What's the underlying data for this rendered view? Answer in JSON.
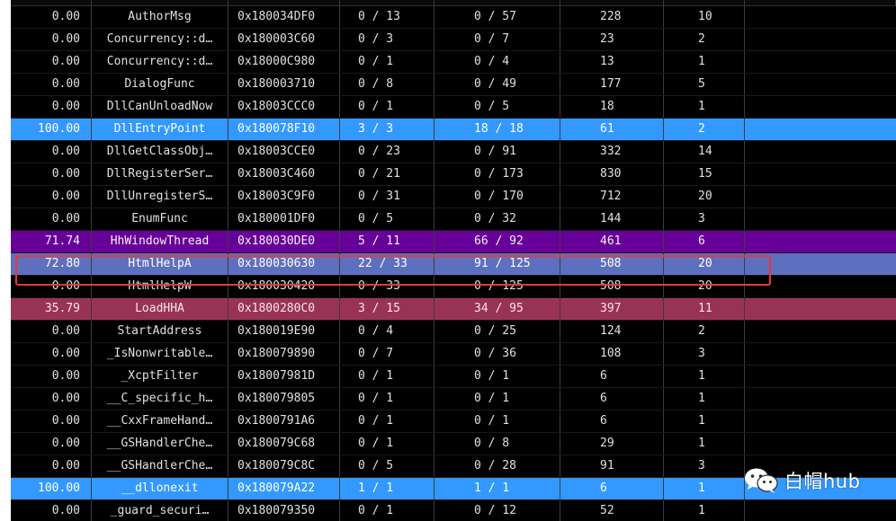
{
  "colors": {
    "background": "#000000",
    "text": "#e0e0e0",
    "selected_blue": "#3399ff",
    "purple": "#660099",
    "slate": "#5f6fbf",
    "rose": "#993355",
    "annotation_box": "#e53a3a"
  },
  "watermark": {
    "icon": "wechat-icon",
    "text": "白帽hub"
  },
  "rows": [
    {
      "cov": "0.00",
      "name": "AuthorMsg",
      "addr": "0x180034DF0",
      "blocks": "0 / 13",
      "instr": "0 / 57",
      "size": "228",
      "cc": "10",
      "style": ""
    },
    {
      "cov": "0.00",
      "name": "Concurrency::d…",
      "addr": "0x180003C60",
      "blocks": "0 / 3",
      "instr": "0 / 7",
      "size": "23",
      "cc": "2",
      "style": ""
    },
    {
      "cov": "0.00",
      "name": "Concurrency::d…",
      "addr": "0x18000C980",
      "blocks": "0 / 1",
      "instr": "0 / 4",
      "size": "13",
      "cc": "1",
      "style": ""
    },
    {
      "cov": "0.00",
      "name": "DialogFunc",
      "addr": "0x180003710",
      "blocks": "0 / 8",
      "instr": "0 / 49",
      "size": "177",
      "cc": "5",
      "style": ""
    },
    {
      "cov": "0.00",
      "name": "DllCanUnloadNow",
      "addr": "0x18003CCC0",
      "blocks": "0 / 1",
      "instr": "0 / 5",
      "size": "18",
      "cc": "1",
      "style": ""
    },
    {
      "cov": "100.00",
      "name": "DllEntryPoint",
      "addr": "0x180078F10",
      "blocks": "3 / 3",
      "instr": "18 / 18",
      "size": "61",
      "cc": "2",
      "style": "hl-blue"
    },
    {
      "cov": "0.00",
      "name": "DllGetClassObj…",
      "addr": "0x18003CCE0",
      "blocks": "0 / 23",
      "instr": "0 / 91",
      "size": "332",
      "cc": "14",
      "style": ""
    },
    {
      "cov": "0.00",
      "name": "DllRegisterSer…",
      "addr": "0x18003C460",
      "blocks": "0 / 21",
      "instr": "0 / 173",
      "size": "830",
      "cc": "15",
      "style": ""
    },
    {
      "cov": "0.00",
      "name": "DllUnregisterS…",
      "addr": "0x18003C9F0",
      "blocks": "0 / 31",
      "instr": "0 / 170",
      "size": "712",
      "cc": "20",
      "style": ""
    },
    {
      "cov": "0.00",
      "name": "EnumFunc",
      "addr": "0x180001DF0",
      "blocks": "0 / 5",
      "instr": "0 / 32",
      "size": "144",
      "cc": "3",
      "style": ""
    },
    {
      "cov": "71.74",
      "name": "HhWindowThread",
      "addr": "0x180030DE0",
      "blocks": "5 / 11",
      "instr": "66 / 92",
      "size": "461",
      "cc": "6",
      "style": "hl-purple"
    },
    {
      "cov": "72.80",
      "name": "HtmlHelpA",
      "addr": "0x180030630",
      "blocks": "22 / 33",
      "instr": "91 / 125",
      "size": "508",
      "cc": "20",
      "style": "hl-slate"
    },
    {
      "cov": "0.00",
      "name": "HtmlHelpW",
      "addr": "0x180030420",
      "blocks": "0 / 33",
      "instr": "0 / 125",
      "size": "508",
      "cc": "20",
      "style": ""
    },
    {
      "cov": "35.79",
      "name": "LoadHHA",
      "addr": "0x1800280C0",
      "blocks": "3 / 15",
      "instr": "34 / 95",
      "size": "397",
      "cc": "11",
      "style": "hl-rose"
    },
    {
      "cov": "0.00",
      "name": "StartAddress",
      "addr": "0x180019E90",
      "blocks": "0 / 4",
      "instr": "0 / 25",
      "size": "124",
      "cc": "2",
      "style": ""
    },
    {
      "cov": "0.00",
      "name": "_IsNonwritable…",
      "addr": "0x180079890",
      "blocks": "0 / 7",
      "instr": "0 / 36",
      "size": "108",
      "cc": "3",
      "style": ""
    },
    {
      "cov": "0.00",
      "name": "_XcptFilter",
      "addr": "0x18007981D",
      "blocks": "0 / 1",
      "instr": "0 / 1",
      "size": "6",
      "cc": "1",
      "style": ""
    },
    {
      "cov": "0.00",
      "name": "__C_specific_h…",
      "addr": "0x180079805",
      "blocks": "0 / 1",
      "instr": "0 / 1",
      "size": "6",
      "cc": "1",
      "style": ""
    },
    {
      "cov": "0.00",
      "name": "__CxxFrameHand…",
      "addr": "0x1800791A6",
      "blocks": "0 / 1",
      "instr": "0 / 1",
      "size": "6",
      "cc": "1",
      "style": ""
    },
    {
      "cov": "0.00",
      "name": "__GSHandlerChe…",
      "addr": "0x180079C68",
      "blocks": "0 / 1",
      "instr": "0 / 8",
      "size": "29",
      "cc": "1",
      "style": ""
    },
    {
      "cov": "0.00",
      "name": "__GSHandlerChe…",
      "addr": "0x180079C8C",
      "blocks": "0 / 5",
      "instr": "0 / 28",
      "size": "91",
      "cc": "3",
      "style": ""
    },
    {
      "cov": "100.00",
      "name": "__dllonexit",
      "addr": "0x180079A22",
      "blocks": "1 / 1",
      "instr": "1 / 1",
      "size": "6",
      "cc": "1",
      "style": "hl-blue"
    },
    {
      "cov": "0.00",
      "name": "_guard_securi…",
      "addr": "0x180079350",
      "blocks": "0 / 1",
      "instr": "0 / 12",
      "size": "52",
      "cc": "1",
      "style": ""
    }
  ]
}
